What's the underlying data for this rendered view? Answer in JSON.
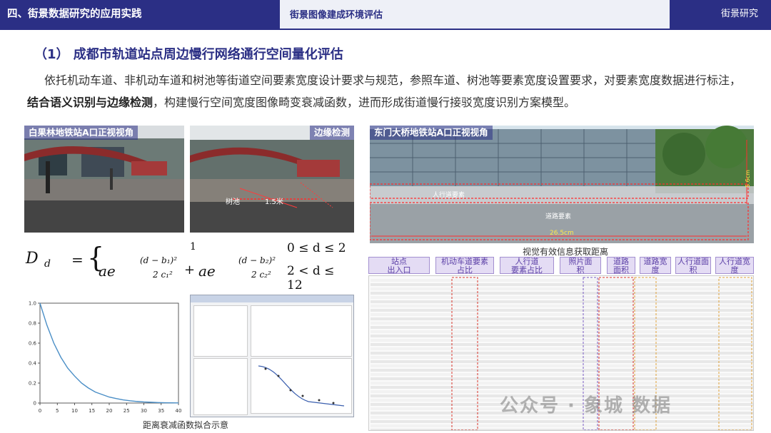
{
  "header": {
    "section": "四、街景数据研究的应用实践",
    "subsection": "街景图像建成环境评估",
    "category": "街景研究"
  },
  "title": "（1） 成都市轨道站点周边慢行网络通行空间量化评估",
  "paragraph": {
    "part1": "依托机动车道、非机动车道和树池等街道空间要素宽度设计要求与规范，参照车道、树池等要素宽度设置要求，对要素宽度数据进行标注，",
    "bold": "结合语义识别与边缘检测",
    "part2": "，构建慢行空间宽度图像畸变衰减函数，进而形成街道慢行接驳宽度识别方案模型。"
  },
  "photos": {
    "photo1_label": "白果林地铁站A口正视视角",
    "photo2_label": "边缘检测",
    "photo2_tree_label": "树池",
    "photo2_width_label": "1.5米",
    "photo3_label": "东门大桥地铁站A口正视视角",
    "photo3_walk_label": "人行道要素",
    "photo3_road_label": "道路要素",
    "photo3_width_label": "26.5cm",
    "photo3_height_label": "5.6cm",
    "photo3_caption": "视觉有效信息获取距离"
  },
  "formula": {
    "lhs_var": "D",
    "lhs_arg": "d",
    "eq": "=",
    "one": "1",
    "ae": "ae",
    "exp1_num": "(d − b₁)²",
    "exp1_den": "2 c₁²",
    "exp2_num": "(d − b₂)²",
    "exp2_den": "2 c₂²",
    "plus": "+",
    "cond1": "0 ≤ d ≤ 2",
    "cond2": "2 < d ≤ 12"
  },
  "chart_data": {
    "type": "line",
    "title": "",
    "xlabel": "",
    "ylabel": "",
    "xlim": [
      0,
      40
    ],
    "ylim": [
      0,
      1.0
    ],
    "x_ticks": [
      "0",
      "5",
      "10",
      "15",
      "20",
      "25",
      "30",
      "35",
      "40"
    ],
    "y_ticks": [
      "0",
      "0.2",
      "0.4",
      "0.6",
      "0.8",
      "1.0"
    ],
    "x": [
      0,
      2,
      4,
      6,
      8,
      10,
      12,
      14,
      16,
      18,
      20,
      22,
      24,
      26,
      28,
      30,
      32,
      34,
      36,
      38,
      40
    ],
    "values": [
      1.0,
      0.78,
      0.6,
      0.46,
      0.35,
      0.27,
      0.2,
      0.15,
      0.11,
      0.085,
      0.06,
      0.045,
      0.032,
      0.023,
      0.016,
      0.011,
      0.008,
      0.005,
      0.003,
      0.002,
      0.001
    ],
    "color": "#4a8ec6",
    "caption": "距离衰减函数拟合示意"
  },
  "table_headers": [
    "站点\n出入口",
    "机动车道要素\n占比",
    "人行道\n要素占比",
    "照片面\n积",
    "道路\n面积",
    "道路宽\n度",
    "人行道面\n积",
    "人行道宽\n度"
  ],
  "watermark": "公众号 · 象城 数据",
  "colors": {
    "brand": "#2b2f85",
    "table_header_bg": "#e4dcf4",
    "table_header_text": "#5b3fa6",
    "highlight_red": "#d9352c"
  }
}
